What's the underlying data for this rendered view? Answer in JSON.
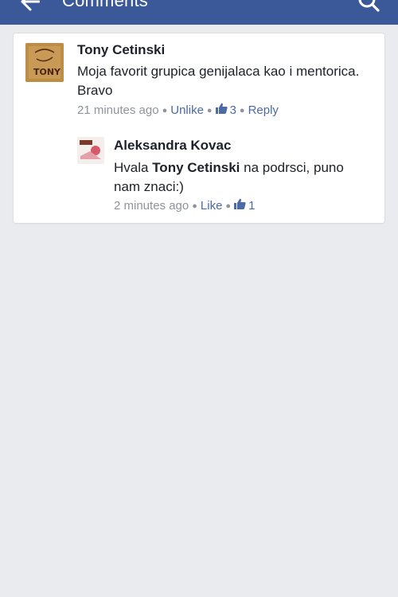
{
  "header": {
    "title": "Comments",
    "back_icon": "arrow-left-icon",
    "search_icon": "search-icon",
    "background_color": "#3b5998"
  },
  "comments": [
    {
      "author": "Tony Cetinski",
      "avatar_text": "TONY",
      "text": "Moja favorit grupica genijalaca kao i mentorica. Bravo",
      "time": "21 minutes ago",
      "like_action": "Unlike",
      "like_count": "3",
      "reply_label": "Reply"
    },
    {
      "author": "Aleksandra Kovac",
      "text_prefix": "Hvala ",
      "text_mention": "Tony Cetinski",
      "text_suffix": " na podrsci, puno nam znaci:)",
      "time": "2 minutes ago",
      "like_action": "Like",
      "like_count": "1"
    }
  ],
  "colors": {
    "page_background": "#e9ebee",
    "link": "#4b6aa6",
    "meta_text": "#90949c",
    "primary_text": "#1d2129"
  }
}
